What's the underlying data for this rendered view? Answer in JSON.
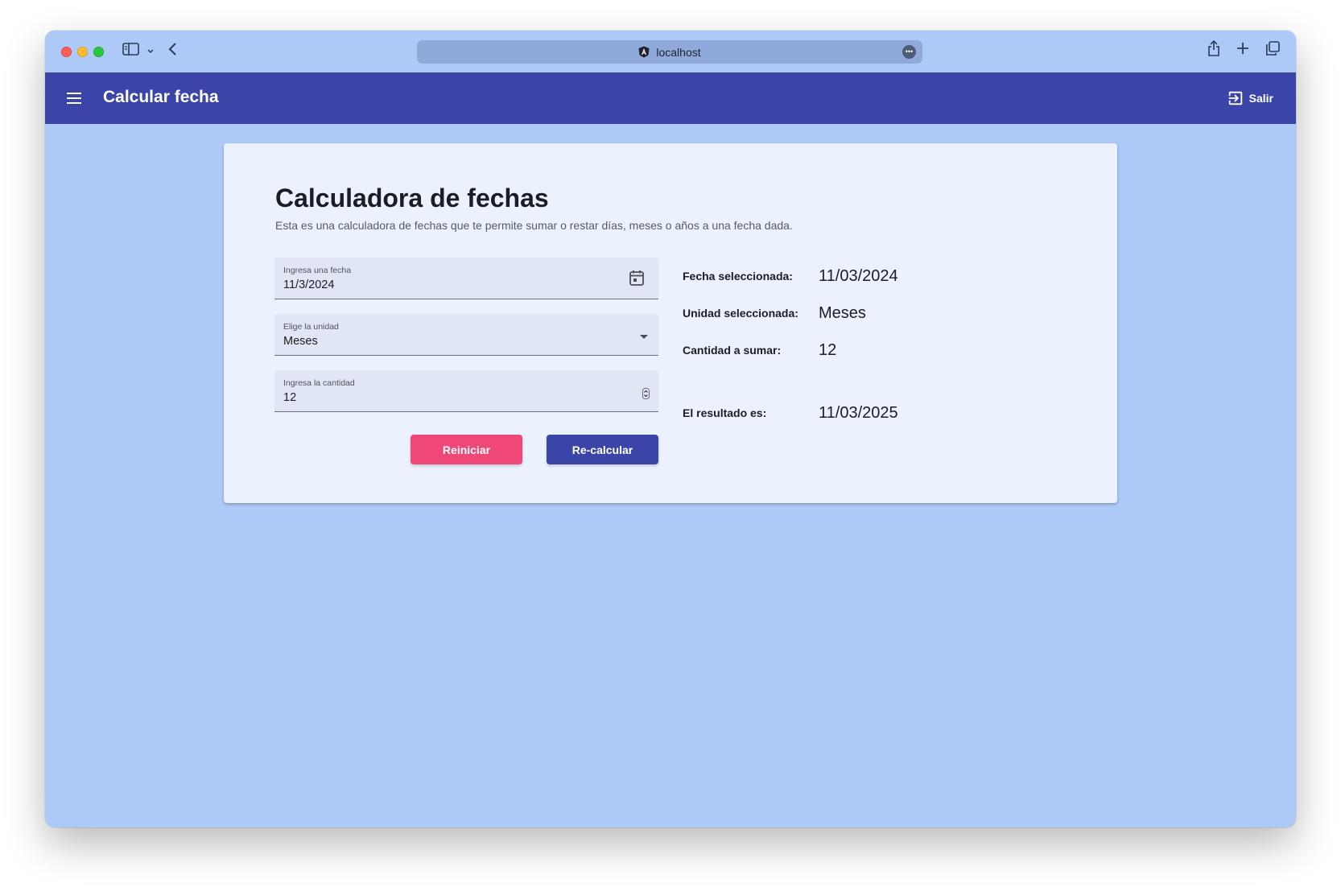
{
  "browser": {
    "url": "localhost"
  },
  "toolbar": {
    "title": "Calcular fecha",
    "logout_label": "Salir"
  },
  "card": {
    "title": "Calculadora de fechas",
    "subtitle": "Esta es una calculadora de fechas que te permite sumar o restar días, meses o años a una fecha dada.",
    "date_field": {
      "label": "Ingresa una fecha",
      "value": "11/3/2024"
    },
    "unit_field": {
      "label": "Elige la unidad",
      "value": "Meses"
    },
    "amount_field": {
      "label": "Ingresa la cantidad",
      "value": "12"
    },
    "buttons": {
      "reset": "Reiniciar",
      "recalc": "Re-calcular"
    },
    "summary": {
      "date_label": "Fecha seleccionada:",
      "date_value": "11/03/2024",
      "unit_label": "Unidad seleccionada:",
      "unit_value": "Meses",
      "amount_label": "Cantidad a sumar:",
      "amount_value": "12",
      "result_label": "El resultado es:",
      "result_value": "11/03/2025"
    }
  },
  "colors": {
    "toolbar": "#3b45a8",
    "background": "#adc9f8",
    "card": "#ecf2fd",
    "reset_button": "#ef4778",
    "recalc_button": "#3b45a8"
  }
}
